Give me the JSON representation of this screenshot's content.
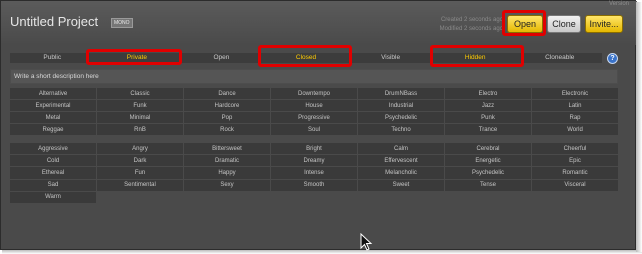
{
  "window": {
    "top_hint": "Version",
    "title": "Untitled Project",
    "badge": "MONO",
    "created": "Created 2 seconds ago",
    "modified": "Modified 2 seconds ago"
  },
  "buttons": {
    "open": "Open",
    "clone": "Clone",
    "invite": "Invite..."
  },
  "tabs": [
    {
      "label": "Public",
      "active": false
    },
    {
      "label": "Private",
      "active": true
    },
    {
      "label": "Open",
      "active": false
    },
    {
      "label": "Closed",
      "active": true
    },
    {
      "label": "Visible",
      "active": false
    },
    {
      "label": "Hidden",
      "active": true
    },
    {
      "label": "Cloneable",
      "active": false
    }
  ],
  "help_label": "?",
  "description_placeholder": "Write a short description here",
  "genres": [
    "Alternative",
    "Classic",
    "Dance",
    "Downtempo",
    "DrumNBass",
    "Electro",
    "Electronic",
    "Experimental",
    "Funk",
    "Hardcore",
    "House",
    "Industrial",
    "Jazz",
    "Latin",
    "Metal",
    "Minimal",
    "Pop",
    "Progressive",
    "Psychedelic",
    "Punk",
    "Rap",
    "Reggae",
    "RnB",
    "Rock",
    "Soul",
    "Techno",
    "Trance",
    "World"
  ],
  "moods": [
    "Aggressive",
    "Angry",
    "Bittersweet",
    "Bright",
    "Calm",
    "Cerebral",
    "Cheerful",
    "Cold",
    "Dark",
    "Dramatic",
    "Dreamy",
    "Effervescent",
    "Energetic",
    "Epic",
    "Ethereal",
    "Fun",
    "Happy",
    "Intense",
    "Melancholic",
    "Psychedelic",
    "Romantic",
    "Sad",
    "Sentimental",
    "Sexy",
    "Smooth",
    "Sweet",
    "Tense",
    "Visceral",
    "Warm"
  ],
  "colors": {
    "panel": "#4a4a4a",
    "cell": "#3a3a3a",
    "accent_yellow": "#ffcc00",
    "highlight_red": "#e00000",
    "help_blue": "#3a73c9"
  }
}
